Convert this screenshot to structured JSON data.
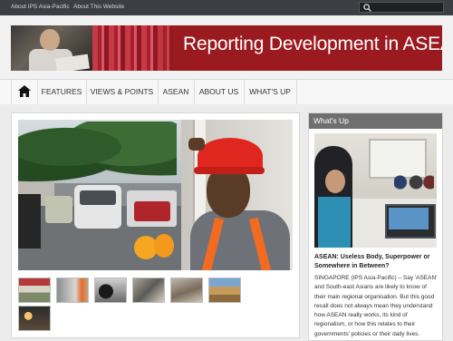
{
  "topbar": {
    "links": [
      "About IPS Asia-Pacific",
      "About This Website"
    ],
    "search_placeholder": ""
  },
  "header": {
    "title": "Reporting Development in ASEAN"
  },
  "nav": {
    "items": [
      "FEATURES",
      "VIEWS & POINTS",
      "ASEAN",
      "ABOUT US",
      "WHAT'S UP"
    ]
  },
  "sidebar": {
    "heading": "What's Up",
    "article_title": "ASEAN: Useless Body, Superpower or Somewhere in Between?",
    "article_text": "SINGAPORE (IPS Asia-Pacific) – Say 'ASEAN' and South-east Asians are likely to know of their main regional organisation. But this good recall does not always mean they understand how ASEAN really works, its kind of regionalism, or how this relates to their governments' policies or their daily lives."
  },
  "colors": {
    "topbar": "#3b3f44",
    "banner": "#9b1a1f",
    "sidebar_heading": "#6f6f6f"
  }
}
